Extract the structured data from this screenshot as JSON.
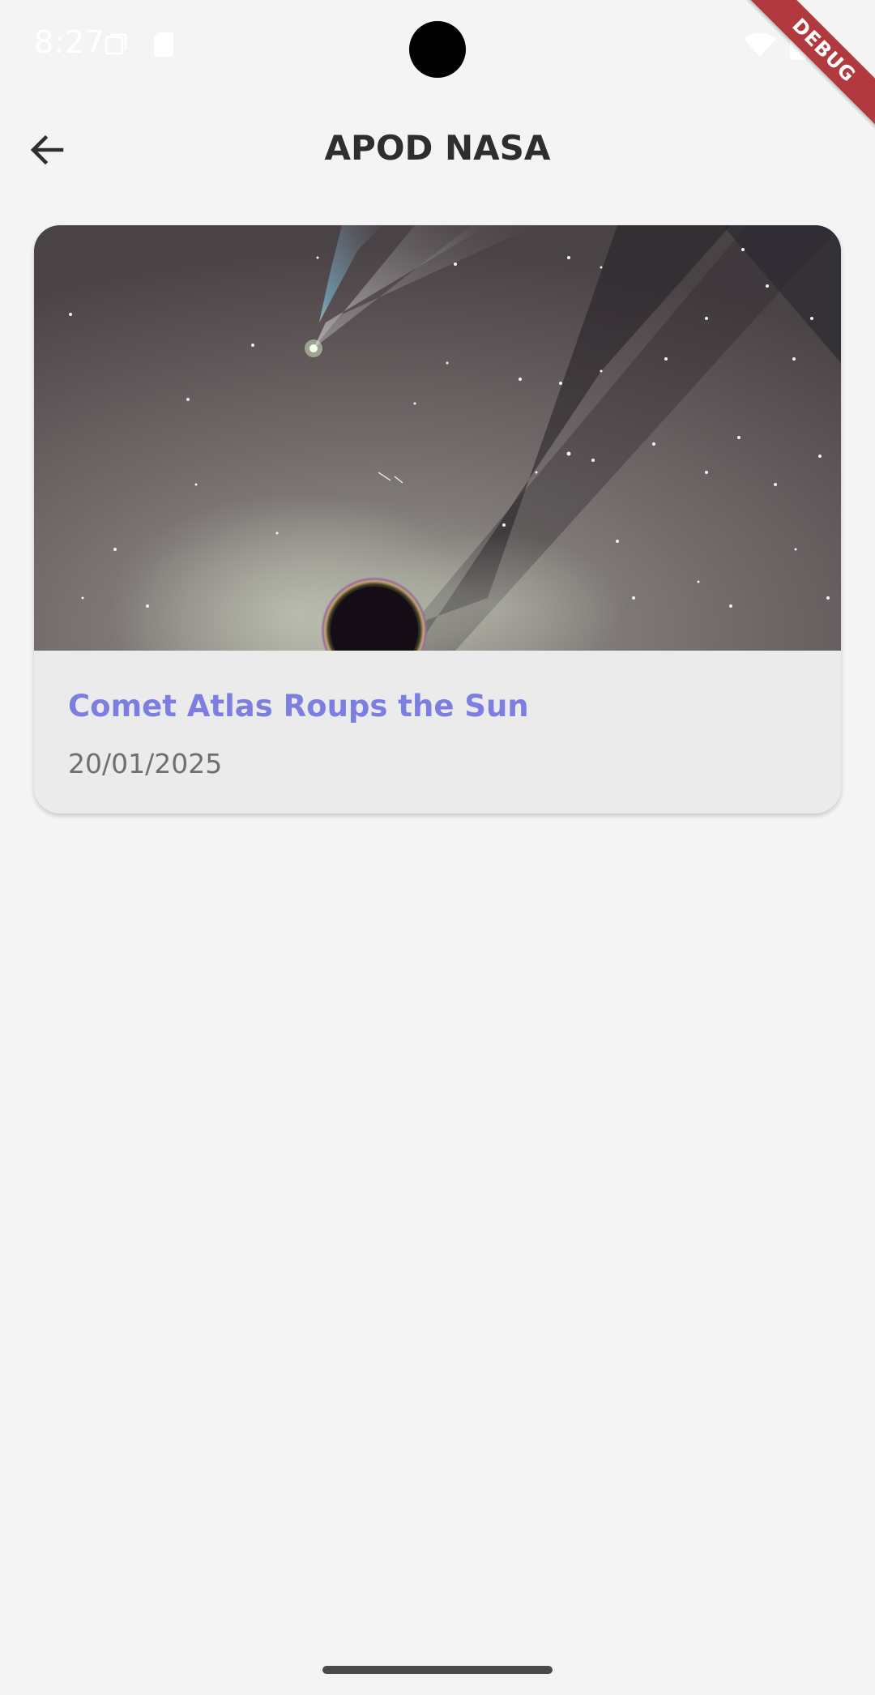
{
  "status_bar": {
    "time": "8:27",
    "icons": [
      "notification-icon",
      "sd-card-icon",
      "wifi-icon",
      "battery-icon"
    ]
  },
  "debug_banner": {
    "label": "DEBUG",
    "color": "#b23a3e"
  },
  "app_bar": {
    "title": "APOD NASA",
    "back_icon": "arrow-back-icon"
  },
  "apod_card": {
    "title": "Comet Atlas Roups the Sun",
    "date": "20/01/2025",
    "image_description": "comet-near-sun-image",
    "title_color": "#7c7fe0"
  },
  "colors": {
    "background": "#f4f4f4",
    "card_background": "#ebebeb",
    "title_text": "#2e2e2e",
    "date_text": "#6f6f6f"
  }
}
